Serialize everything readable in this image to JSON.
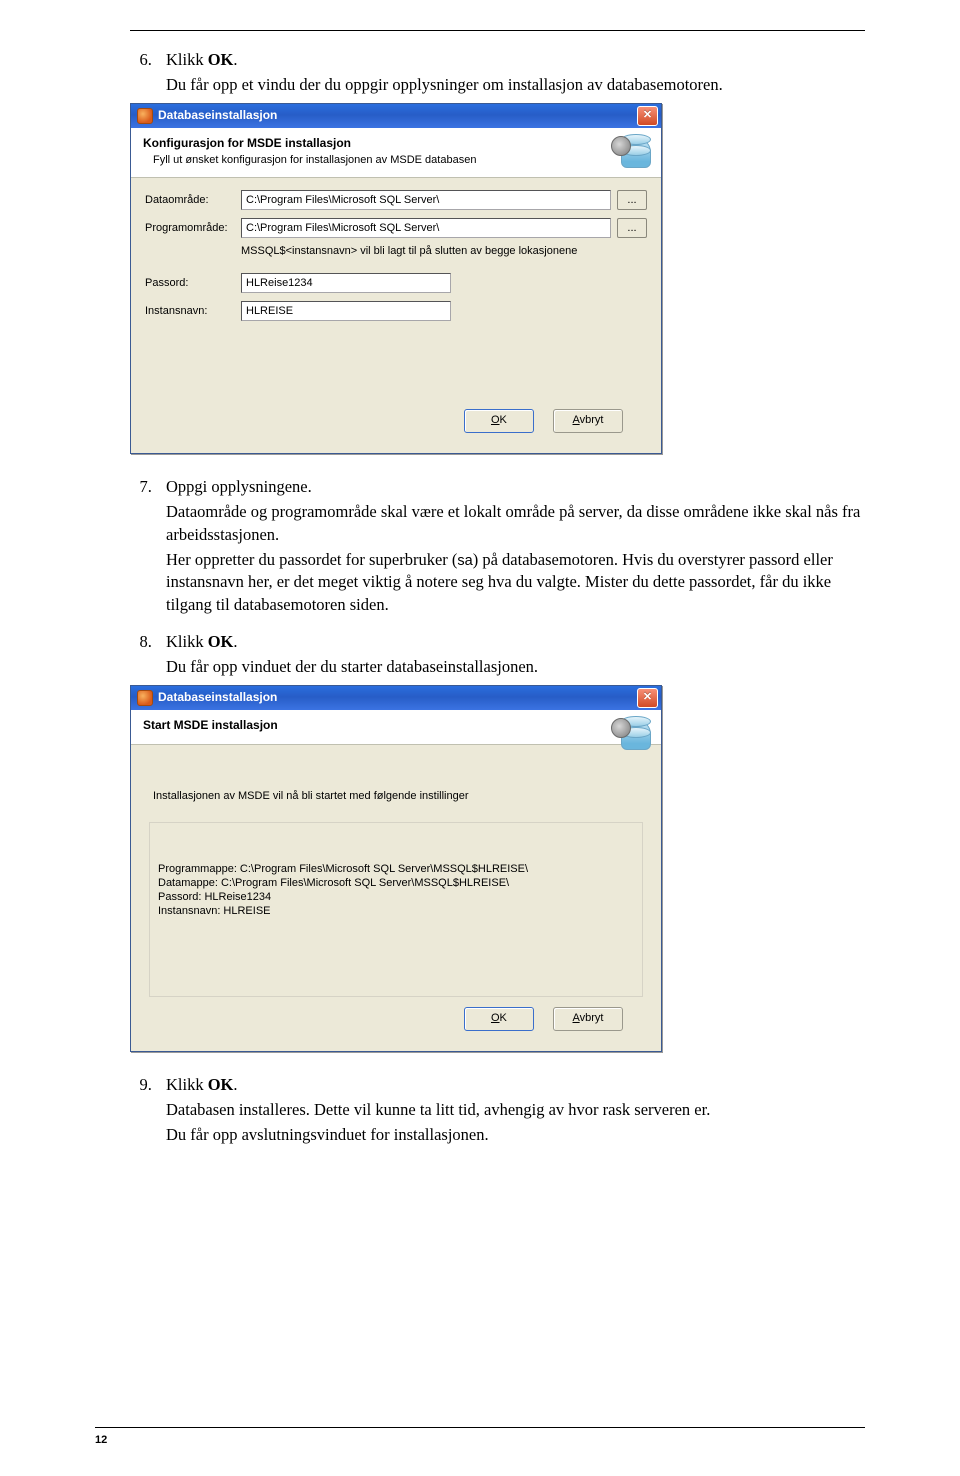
{
  "page_number": "12",
  "steps": {
    "s6": {
      "click": "Klikk ",
      "ok": "OK",
      "dot": ".",
      "line2": "Du får opp et vindu der du oppgir opplysninger om installasjon av databasemotoren."
    },
    "s7": {
      "title": "Oppgi opplysningene.",
      "p1": "Dataområde og programområde skal være et lokalt område på server, da disse områdene ikke skal nås fra arbeidsstasjonen.",
      "p2a": "Her oppretter du passordet for superbruker (",
      "p2sa": "sa",
      "p2b": ") på databasemotoren. Hvis du overstyrer passord eller instansnavn her, er det meget viktig å notere seg hva du valgte. Mister du dette passordet, får du ikke tilgang til databasemotoren siden."
    },
    "s8": {
      "click": "Klikk ",
      "ok": "OK",
      "dot": ".",
      "line2": "Du får opp vinduet der du starter databaseinstallasjonen."
    },
    "s9": {
      "click": "Klikk ",
      "ok": "OK",
      "dot": ".",
      "p1": "Databasen installeres. Dette vil kunne ta litt tid, avhengig av hvor rask serveren er.",
      "p2": "Du får opp avslutningsvinduet for installasjonen."
    }
  },
  "dialog1": {
    "title": "Databaseinstallasjon",
    "header": "Konfigurasjon for MSDE installasjon",
    "subheader": "Fyll ut ønsket konfigurasjon for installasjonen av MSDE databasen",
    "labels": {
      "data": "Dataområde:",
      "prog": "Programområde:",
      "pass": "Passord:",
      "inst": "Instansnavn:"
    },
    "values": {
      "data": "C:\\Program Files\\Microsoft SQL Server\\",
      "prog": "C:\\Program Files\\Microsoft SQL Server\\",
      "pass": "HLReise1234",
      "inst": "HLREISE"
    },
    "browse": "...",
    "note": "MSSQL$<instansnavn> vil bli lagt til på slutten av begge lokasjonene",
    "ok": "OK",
    "ok_u": "O",
    "avbryt": "vbryt",
    "avbryt_u": "A"
  },
  "dialog2": {
    "title": "Databaseinstallasjon",
    "header": "Start MSDE installasjon",
    "info": "Installasjonen av MSDE vil nå bli startet med følgende instillinger",
    "lines": {
      "l1": "Programmappe: C:\\Program Files\\Microsoft SQL Server\\MSSQL$HLREISE\\",
      "l2": "Datamappe: C:\\Program Files\\Microsoft SQL Server\\MSSQL$HLREISE\\",
      "l3": "Passord: HLReise1234",
      "l4": "Instansnavn: HLREISE"
    },
    "ok": "OK",
    "ok_u": "O",
    "avbryt": "vbryt",
    "avbryt_u": "A"
  }
}
